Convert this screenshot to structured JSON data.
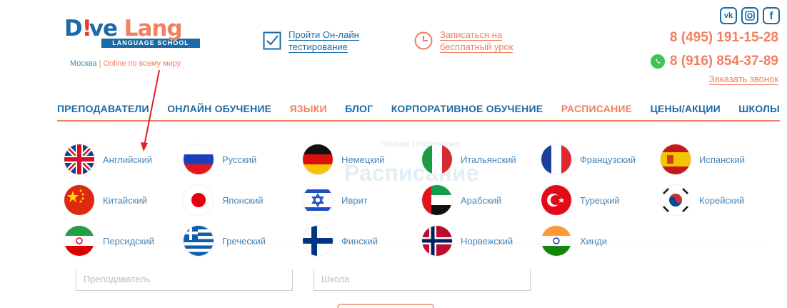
{
  "logo": {
    "part1": "D",
    "part2": "ve",
    "part3": " Lang",
    "subtitle": "LANGUAGE SCHOOL",
    "city": "Москва",
    "separator": "|",
    "online": "Online по всему миру"
  },
  "header": {
    "test_line1": "Пройти Он-лайн",
    "test_line2": "тестирование",
    "lesson_line1": "Записаться на",
    "lesson_line2": "бесплатный урок",
    "phone1": "8 (495) 191-15-28",
    "phone2": "8 (916) 854-37-89",
    "callback": "Заказать звонок",
    "socials": [
      "vk",
      "instagram",
      "facebook"
    ]
  },
  "nav": [
    {
      "label": "ПРЕПОДАВАТЕЛИ",
      "active": false
    },
    {
      "label": "ОНЛАЙН ОБУЧЕНИЕ",
      "active": false
    },
    {
      "label": "ЯЗЫКИ",
      "active": true
    },
    {
      "label": "БЛОГ",
      "active": false
    },
    {
      "label": "КОРПОРАТИВНОЕ ОБУЧЕНИЕ",
      "active": false
    },
    {
      "label": "РАСПИСАНИЕ",
      "active": true
    },
    {
      "label": "ЦЕНЫ/АКЦИИ",
      "active": false
    },
    {
      "label": "ШКОЛЫ",
      "active": false
    }
  ],
  "background": {
    "crumb": "Главная / Расписание",
    "title": "Расписание",
    "select_teacher": "Преподаватель",
    "select_school": "Школа"
  },
  "languages": [
    {
      "name": "Английский",
      "flag": "uk"
    },
    {
      "name": "Русский",
      "flag": "ru"
    },
    {
      "name": "Немецкий",
      "flag": "de"
    },
    {
      "name": "Итальянский",
      "flag": "it"
    },
    {
      "name": "Французский",
      "flag": "fr"
    },
    {
      "name": "Испанский",
      "flag": "es"
    },
    {
      "name": "Китайский",
      "flag": "cn"
    },
    {
      "name": "Японский",
      "flag": "jp"
    },
    {
      "name": "Иврит",
      "flag": "il"
    },
    {
      "name": "Арабский",
      "flag": "ae"
    },
    {
      "name": "Турецкий",
      "flag": "tr"
    },
    {
      "name": "Корейский",
      "flag": "kr"
    },
    {
      "name": "Персидский",
      "flag": "ir"
    },
    {
      "name": "Греческий",
      "flag": "gr"
    },
    {
      "name": "Финский",
      "flag": "fi"
    },
    {
      "name": "Норвежский",
      "flag": "no"
    },
    {
      "name": "Хинди",
      "flag": "in"
    }
  ],
  "colors": {
    "brand_blue": "#1b6aa5",
    "accent_orange": "#f08060",
    "annotation_red": "#e02020"
  }
}
